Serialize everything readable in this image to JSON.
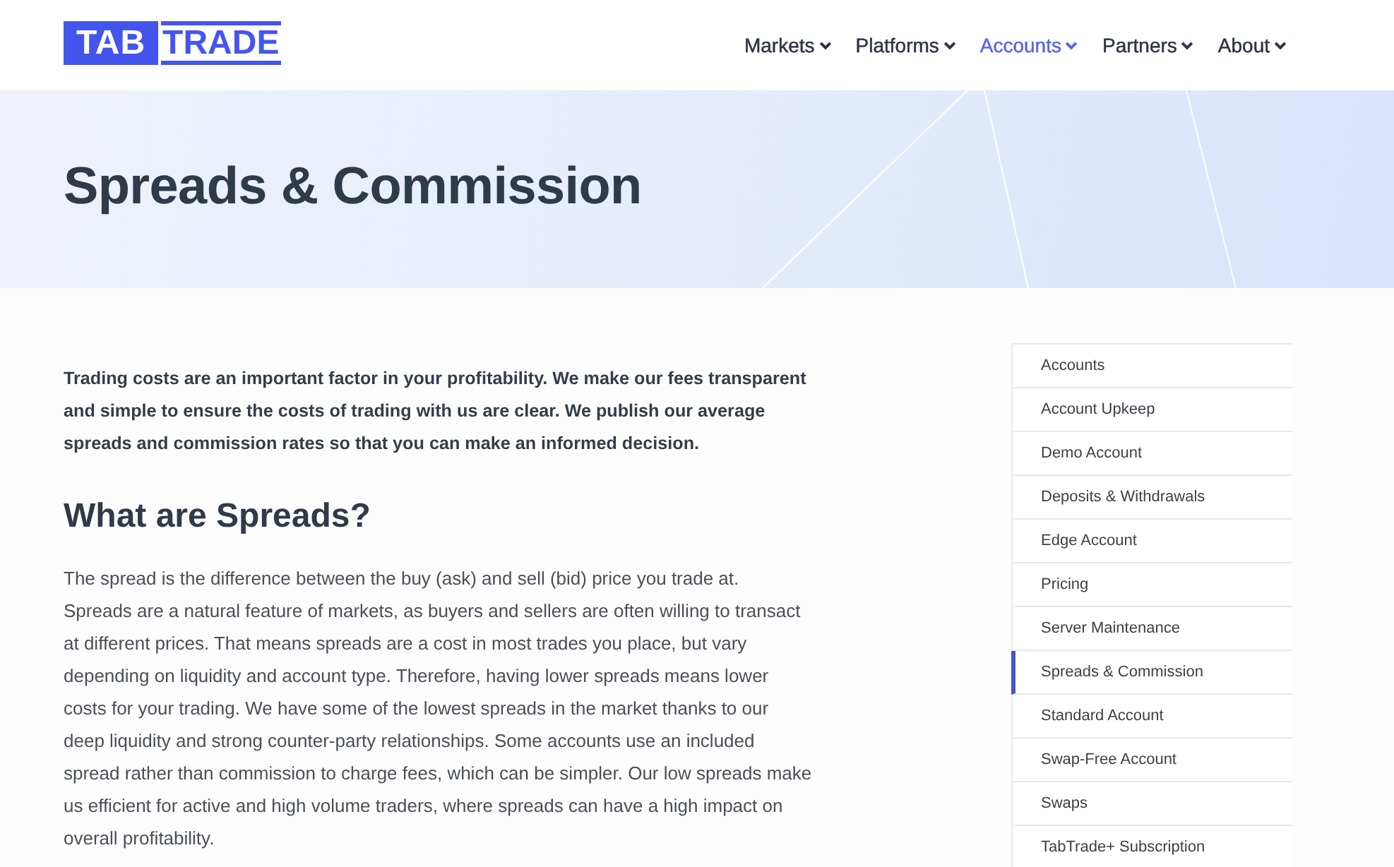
{
  "header": {
    "logo": {
      "badge": "TAB",
      "wordmark": "TRADE"
    },
    "nav": [
      {
        "label": "Markets",
        "selected": false
      },
      {
        "label": "Platforms",
        "selected": false
      },
      {
        "label": "Accounts",
        "selected": true
      },
      {
        "label": "Partners",
        "selected": false
      },
      {
        "label": "About",
        "selected": false
      }
    ]
  },
  "hero": {
    "title": "Spreads & Commission"
  },
  "content": {
    "intro": "Trading costs are an important factor in your profitability. We make our fees transparent and simple to ensure the costs of trading with us are clear. We publish our average spreads and commission rates so that you can make an informed decision.",
    "heading": "What are Spreads?",
    "paragraph": "The spread is the difference between the buy (ask) and sell (bid) price you trade at. Spreads are a natural feature of markets, as buyers and sellers are often willing to transact at different prices. That means spreads are a cost in most trades you place, but vary depending on liquidity and account type. Therefore, having lower spreads means lower costs for your trading. We have some of the lowest spreads in the market thanks to our deep liquidity and strong counter-party relationships. Some accounts use an included spread rather than commission to charge fees, which can be simpler. Our low spreads make us efficient for active and high volume traders, where spreads can have a high impact on overall profitability."
  },
  "sidebar": {
    "items": [
      {
        "label": "Accounts",
        "selected": false
      },
      {
        "label": "Account Upkeep",
        "selected": false
      },
      {
        "label": "Demo Account",
        "selected": false
      },
      {
        "label": "Deposits & Withdrawals",
        "selected": false
      },
      {
        "label": "Edge Account",
        "selected": false
      },
      {
        "label": "Pricing",
        "selected": false
      },
      {
        "label": "Server Maintenance",
        "selected": false
      },
      {
        "label": "Spreads & Commission",
        "selected": true
      },
      {
        "label": "Standard Account",
        "selected": false
      },
      {
        "label": "Swap-Free Account",
        "selected": false
      },
      {
        "label": "Swaps",
        "selected": false
      },
      {
        "label": "TabTrade+ Subscription",
        "selected": false
      }
    ]
  }
}
